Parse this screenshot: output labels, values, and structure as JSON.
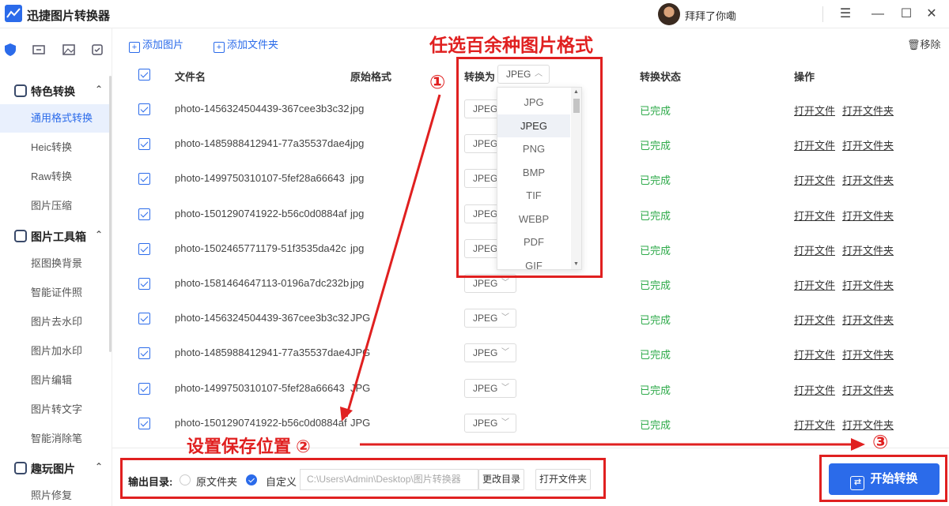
{
  "app": {
    "title": "迅捷图片转换器",
    "user_name": "拜拜了你嘞"
  },
  "window_controls": {
    "menu": "☰",
    "minimize": "—",
    "maximize": "☐",
    "close": "✕"
  },
  "sidebar": {
    "sections": [
      {
        "label": "特色转换",
        "items": [
          "通用格式转换",
          "Heic转换",
          "Raw转换",
          "图片压缩"
        ]
      },
      {
        "label": "图片工具箱",
        "items": [
          "抠图换背景",
          "智能证件照",
          "图片去水印",
          "图片加水印",
          "图片编辑",
          "图片转文字",
          "智能消除笔"
        ]
      },
      {
        "label": "趣玩图片",
        "items": [
          "照片修复"
        ]
      }
    ],
    "active_item": "通用格式转换"
  },
  "toolbar": {
    "add_image": "添加图片",
    "add_folder": "添加文件夹",
    "remove": "移除"
  },
  "table": {
    "headers": {
      "filename": "文件名",
      "original_format": "原始格式",
      "convert_to": "转换为",
      "status": "转换状态",
      "actions": "操作"
    },
    "header_select_value": "JPEG",
    "rows": [
      {
        "filename": "photo-1456324504439-367cee3b3c32",
        "format": "jpg",
        "target": "JPEG",
        "status": "已完成"
      },
      {
        "filename": "photo-1485988412941-77a35537dae4",
        "format": "jpg",
        "target": "JPEG",
        "status": "已完成"
      },
      {
        "filename": "photo-1499750310107-5fef28a66643",
        "format": "jpg",
        "target": "JPEG",
        "status": "已完成"
      },
      {
        "filename": "photo-1501290741922-b56c0d0884af",
        "format": "jpg",
        "target": "JPEG",
        "status": "已完成"
      },
      {
        "filename": "photo-1502465771179-51f3535da42c",
        "format": "jpg",
        "target": "JPEG",
        "status": "已完成"
      },
      {
        "filename": "photo-1581464647113-0196a7dc232b",
        "format": "jpg",
        "target": "JPEG",
        "status": "已完成"
      },
      {
        "filename": "photo-1456324504439-367cee3b3c32",
        "format": "JPG",
        "target": "JPEG",
        "status": "已完成"
      },
      {
        "filename": "photo-1485988412941-77a35537dae4",
        "format": "JPG",
        "target": "JPEG",
        "status": "已完成"
      },
      {
        "filename": "photo-1499750310107-5fef28a66643",
        "format": "JPG",
        "target": "JPEG",
        "status": "已完成"
      },
      {
        "filename": "photo-1501290741922-b56c0d0884af",
        "format": "JPG",
        "target": "JPEG",
        "status": "已完成"
      }
    ],
    "open_file": "打开文件",
    "open_folder": "打开文件夹"
  },
  "dropdown": {
    "options": [
      "JPG",
      "JPEG",
      "PNG",
      "BMP",
      "TIF",
      "WEBP",
      "PDF",
      "GIF"
    ],
    "selected": "JPEG"
  },
  "output": {
    "label": "输出目录:",
    "option_original": "原文件夹",
    "option_custom": "自定义",
    "path": "C:\\Users\\Admin\\Desktop\\图片转换器",
    "change_dir": "更改目录",
    "open_folder": "打开文件夹"
  },
  "start_button": "开始转换",
  "annotations": {
    "title": "任选百余种图片格式",
    "step1": "①",
    "step2_label": "设置保存位置 ②",
    "step3": "③"
  },
  "colors": {
    "accent": "#2b6bea",
    "annotation": "#e02020",
    "status_done": "#2eaa4a"
  }
}
